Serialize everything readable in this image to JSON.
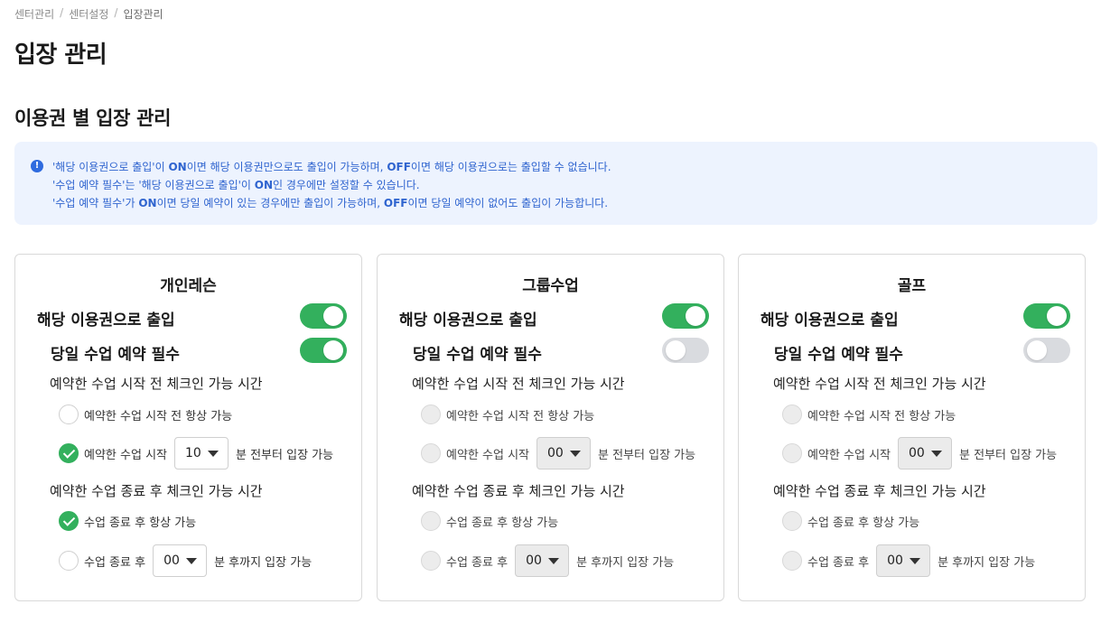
{
  "breadcrumb": [
    "센터관리",
    "센터설정",
    "입장관리"
  ],
  "page_title": "입장 관리",
  "section_title": "이용권 별 입장 관리",
  "info": {
    "line1": {
      "a": "'해당 이용권으로 출입'이 ",
      "b": "ON",
      "c": "이면 해당 이용권만으로도 출입이 가능하며, ",
      "d": "OFF",
      "e": "이면 해당 이용권으로는 출입할 수 없습니다."
    },
    "line2": {
      "a": "'수업 예약 필수'는 '해당 이용권으로 출입'이 ",
      "b": "ON",
      "c": "인 경우에만 설정할 수 있습니다."
    },
    "line3": {
      "a": "'수업 예약 필수'가 ",
      "b": "ON",
      "c": "이면 당일 예약이 있는 경우에만 출입이 가능하며, ",
      "d": "OFF",
      "e": "이면 당일 예약이 없어도 출입이 가능합니다."
    }
  },
  "labels": {
    "entry_toggle": "해당 이용권으로 출입",
    "reservation_required": "당일 수업 예약 필수",
    "before_title": "예약한 수업 시작 전 체크인 가능 시간",
    "before_always": "예약한 수업 시작 전 항상 가능",
    "before_prefix": "예약한 수업 시작",
    "before_suffix": "분 전부터 입장 가능",
    "after_title": "예약한 수업 종료 후 체크인 가능 시간",
    "after_always": "수업 종료 후 항상 가능",
    "after_prefix": "수업 종료 후",
    "after_suffix": "분 후까지 입장 가능"
  },
  "cards": [
    {
      "title": "개인레슨",
      "entry_on": true,
      "reservation_on": true,
      "before_minutes": "10",
      "after_minutes": "00",
      "before_choice": "minutes",
      "after_choice": "always"
    },
    {
      "title": "그룹수업",
      "entry_on": true,
      "reservation_on": false,
      "before_minutes": "00",
      "after_minutes": "00",
      "before_choice": "none",
      "after_choice": "none"
    },
    {
      "title": "골프",
      "entry_on": true,
      "reservation_on": false,
      "before_minutes": "00",
      "after_minutes": "00",
      "before_choice": "none",
      "after_choice": "none"
    }
  ],
  "colors": {
    "toggle_on": "#33b05d",
    "toggle_off": "#d9dbdf",
    "info_bg": "#edf3fe",
    "info_text": "#2f64cf"
  }
}
